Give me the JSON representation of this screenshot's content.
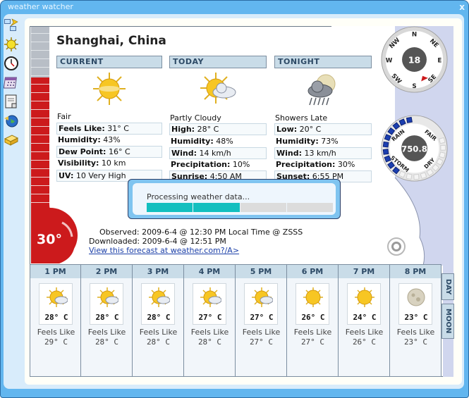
{
  "window": {
    "title": "weather watcher",
    "close_label": "x"
  },
  "sidebar": {
    "items": [
      {
        "name": "locations-icon"
      },
      {
        "name": "weather-icon"
      },
      {
        "name": "clock-icon"
      },
      {
        "name": "calendar-icon"
      },
      {
        "name": "report-icon"
      },
      {
        "name": "globe-icon"
      },
      {
        "name": "toolbox-icon"
      }
    ]
  },
  "location": "Shanghai, China",
  "thermometer": {
    "temperature": "30°",
    "fill_percent": 76
  },
  "current": {
    "header": "CURRENT",
    "condition": "Fair",
    "rows": [
      {
        "label": "Feels Like:",
        "value": "31° C"
      },
      {
        "label": "Humidity:",
        "value": "43%"
      },
      {
        "label": "Dew Point:",
        "value": "16° C"
      },
      {
        "label": "Visibility:",
        "value": "10 km"
      },
      {
        "label": "UV:",
        "value": "10 Very High"
      }
    ]
  },
  "today": {
    "header": "TODAY",
    "condition": "Partly Cloudy",
    "rows": [
      {
        "label": "High:",
        "value": "28° C"
      },
      {
        "label": "Humidity:",
        "value": "48%"
      },
      {
        "label": "Wind:",
        "value": "14 km/h"
      },
      {
        "label": "Precipitation:",
        "value": "10%"
      },
      {
        "label": "Sunrise:",
        "value": "4:50 AM"
      }
    ]
  },
  "tonight": {
    "header": "TONIGHT",
    "condition": "Showers Late",
    "rows": [
      {
        "label": "Low:",
        "value": "20° C"
      },
      {
        "label": "Humidity:",
        "value": "73%"
      },
      {
        "label": "Wind:",
        "value": "13 km/h"
      },
      {
        "label": "Precipitation:",
        "value": "30%"
      },
      {
        "label": "Sunset:",
        "value": "6:55 PM"
      }
    ]
  },
  "dialog": {
    "message": "Processing weather data...",
    "progress_segments_filled": 2,
    "progress_segments_total": 4
  },
  "observed": {
    "observed_line": "Observed: 2009-6-4 @ 12:30 PM Local Time @ ZSSS",
    "downloaded_line": "Downloaded: 2009-6-4 @ 12:51 PM",
    "link_text": "View this forecast at weather.com?/A>"
  },
  "compass": {
    "speed": "18",
    "directions": [
      "N",
      "NE",
      "E",
      "SE",
      "S",
      "SW",
      "W",
      "NW"
    ],
    "pointer_direction": "SE"
  },
  "barometer": {
    "pressure": "750.8",
    "labels": [
      "RAIN",
      "FAIR",
      "DRY",
      "STORM"
    ],
    "level_fraction": 0.5
  },
  "hourly": [
    {
      "time": "1 PM",
      "icon": "partly-cloudy",
      "temp": "28° C",
      "feels_label": "Feels Like",
      "feels": "29° C"
    },
    {
      "time": "2 PM",
      "icon": "partly-cloudy",
      "temp": "28° C",
      "feels_label": "Feels Like",
      "feels": "28° C"
    },
    {
      "time": "3 PM",
      "icon": "partly-cloudy",
      "temp": "28° C",
      "feels_label": "Feels Like",
      "feels": "28° C"
    },
    {
      "time": "4 PM",
      "icon": "partly-cloudy",
      "temp": "27° C",
      "feels_label": "Feels Like",
      "feels": "28° C"
    },
    {
      "time": "5 PM",
      "icon": "partly-cloudy",
      "temp": "27° C",
      "feels_label": "Feels Like",
      "feels": "27° C"
    },
    {
      "time": "6 PM",
      "icon": "sunny",
      "temp": "26° C",
      "feels_label": "Feels Like",
      "feels": "27° C"
    },
    {
      "time": "7 PM",
      "icon": "sunny",
      "temp": "24° C",
      "feels_label": "Feels Like",
      "feels": "26° C"
    },
    {
      "time": "8 PM",
      "icon": "moon",
      "temp": "23° C",
      "feels_label": "Feels Like",
      "feels": "23° C"
    }
  ],
  "tabs": {
    "day": "DAY",
    "moon": "MOON"
  },
  "colors": {
    "thermo_red": "#cc1a1c",
    "progress_teal": "#13bfbf",
    "header_bg": "#c9dce8",
    "window_blue": "#62b6ef"
  }
}
